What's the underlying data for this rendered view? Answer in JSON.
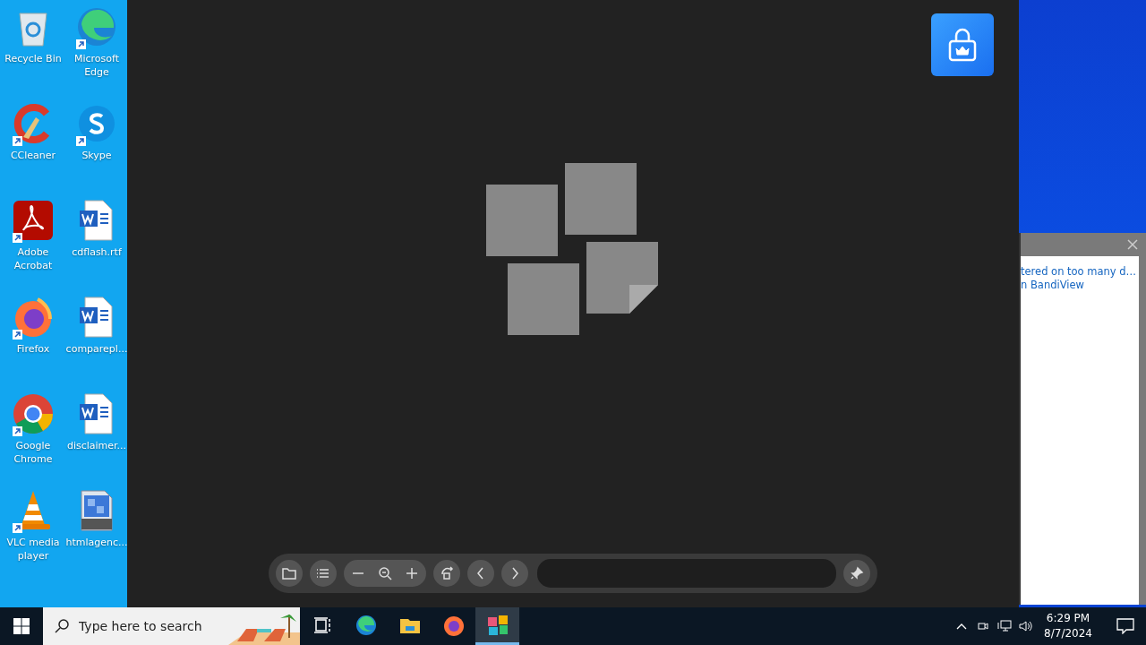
{
  "desktop_icons": [
    {
      "label": "Recycle Bin",
      "kind": "recycle",
      "shortcut": false
    },
    {
      "label": "Microsoft Edge",
      "kind": "edge",
      "shortcut": true
    },
    {
      "label": "CCleaner",
      "kind": "ccleaner",
      "shortcut": true
    },
    {
      "label": "Skype",
      "kind": "skype",
      "shortcut": true
    },
    {
      "label": "Adobe Acrobat",
      "kind": "acrobat",
      "shortcut": true
    },
    {
      "label": "cdflash.rtf",
      "kind": "word",
      "shortcut": false
    },
    {
      "label": "Firefox",
      "kind": "firefox",
      "shortcut": true
    },
    {
      "label": "comparepl...",
      "kind": "word",
      "shortcut": false
    },
    {
      "label": "Google Chrome",
      "kind": "chrome",
      "shortcut": true
    },
    {
      "label": "disclaimer...",
      "kind": "word",
      "shortcut": false
    },
    {
      "label": "VLC media player",
      "kind": "vlc",
      "shortcut": true
    },
    {
      "label": "htmlagenc...",
      "kind": "png",
      "shortcut": false
    }
  ],
  "viewer": {
    "toolbar": [
      {
        "kind": "open"
      },
      {
        "kind": "list"
      },
      {
        "kind": "zoom-group"
      },
      {
        "kind": "rotate"
      },
      {
        "kind": "prev"
      },
      {
        "kind": "next"
      },
      {
        "kind": "path"
      },
      {
        "kind": "pin"
      }
    ]
  },
  "popup": {
    "lines": [
      "tered on too many d…",
      "n BandiView"
    ]
  },
  "taskbar": {
    "search": {
      "placeholder": "Type here to search"
    },
    "apps": [
      {
        "kind": "taskview",
        "selected": false
      },
      {
        "kind": "edge",
        "selected": false
      },
      {
        "kind": "explorer",
        "selected": false
      },
      {
        "kind": "firefox",
        "selected": false
      },
      {
        "kind": "bandiview",
        "selected": true
      }
    ],
    "clock": {
      "time": "6:29 PM",
      "date": "8/7/2024"
    }
  }
}
